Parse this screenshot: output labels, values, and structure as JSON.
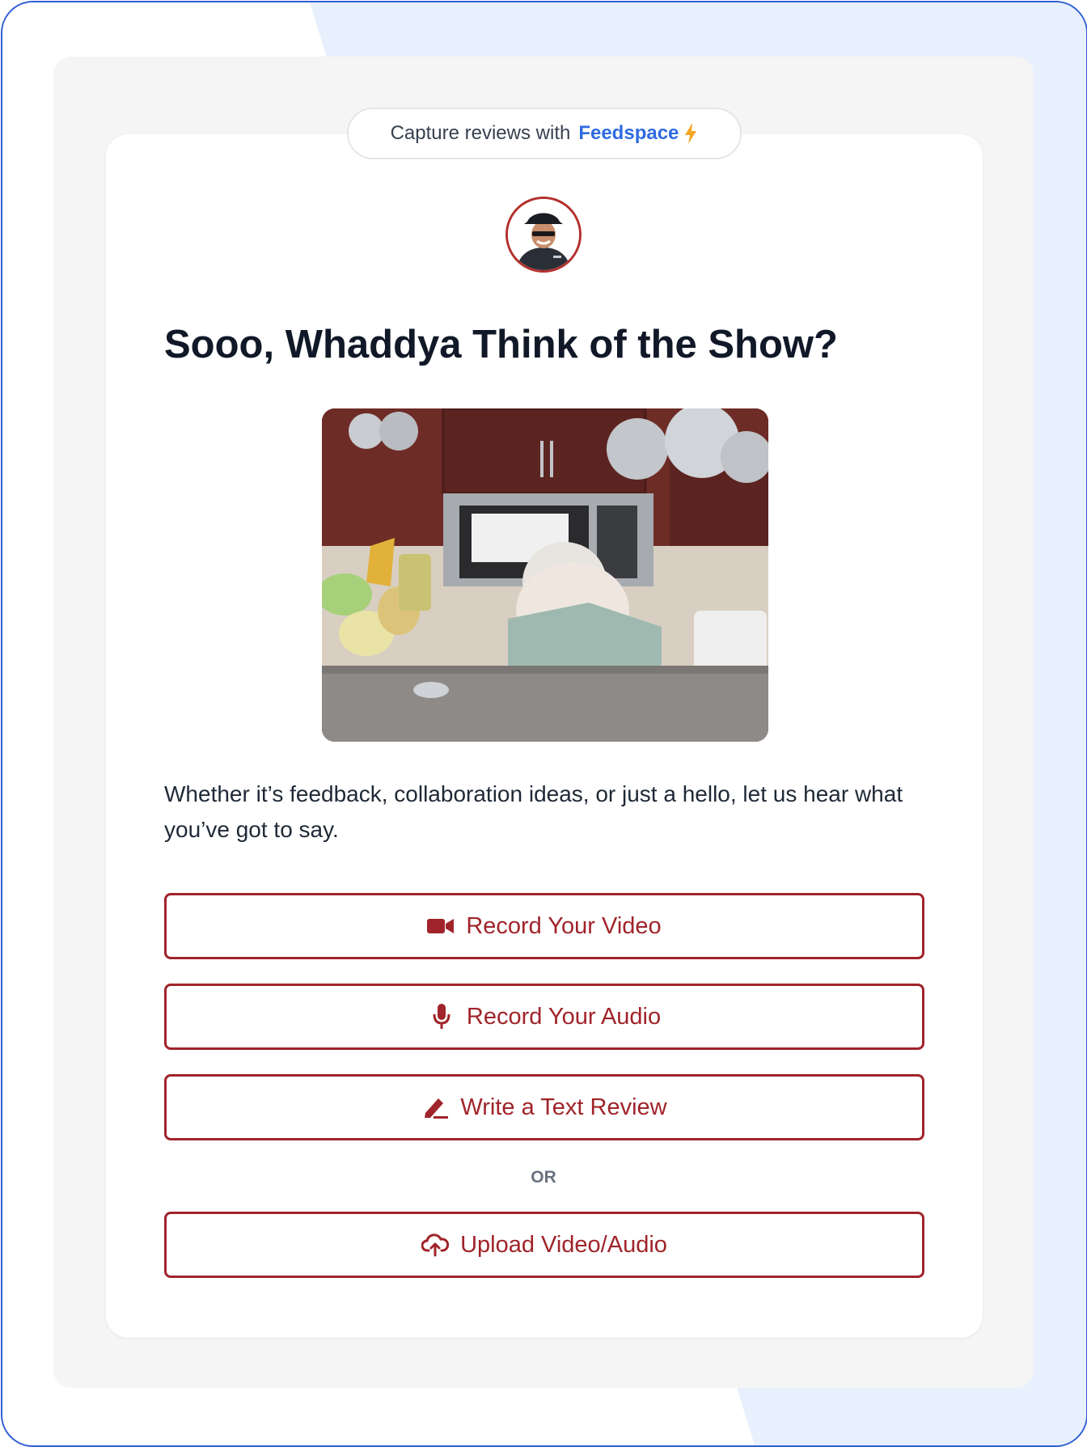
{
  "badge": {
    "prefix": "Capture reviews with",
    "brand": "Feedspace",
    "brand_color": "#2f6be0",
    "icon": "lightning-bolt-icon"
  },
  "avatar": {
    "icon": "avatar-image"
  },
  "title": "Sooo, Whaddya Think of the Show?",
  "media": {
    "icon": "kitchen-gif-image"
  },
  "description": "Whether it’s feedback, collaboration ideas, or just a hello, let us hear what you’ve got to say.",
  "buttons": [
    {
      "label": "Record Your Video",
      "icon": "video-camera-icon"
    },
    {
      "label": "Record Your Audio",
      "icon": "microphone-icon"
    },
    {
      "label": "Write a Text Review",
      "icon": "pencil-icon"
    }
  ],
  "separator": "OR",
  "upload_button": {
    "label": "Upload Video/Audio",
    "icon": "cloud-upload-icon"
  },
  "colors": {
    "accent": "#a0242a",
    "frame_border": "#2f5fd0",
    "background_shape": "#e9f0fd"
  }
}
